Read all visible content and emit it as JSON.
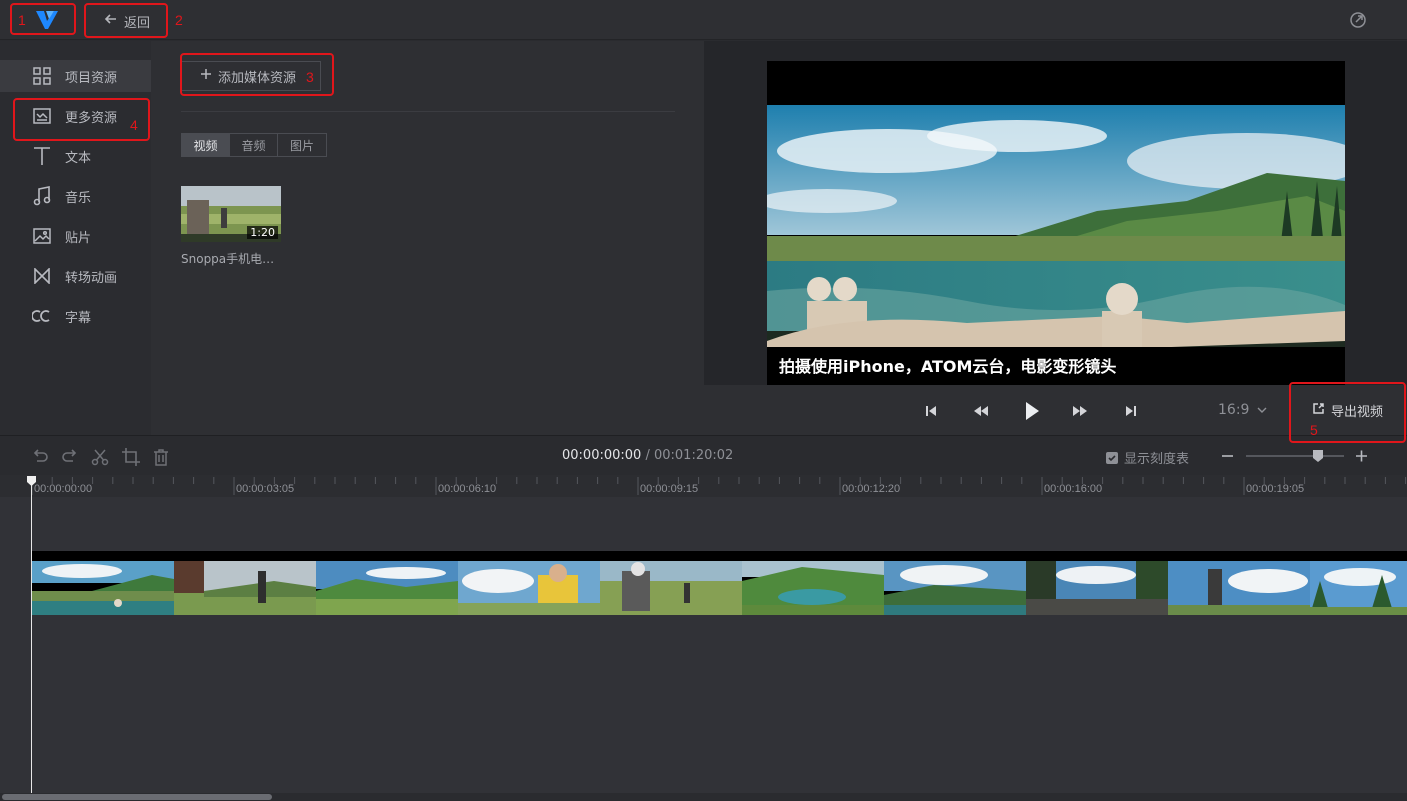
{
  "topbar": {
    "back_label": "返回"
  },
  "annotations": [
    "1",
    "2",
    "3",
    "4",
    "5"
  ],
  "sidebar": {
    "items": [
      {
        "label": "项目资源",
        "icon": "grid-icon",
        "active": true
      },
      {
        "label": "更多资源",
        "icon": "resource-box-icon",
        "active": false
      },
      {
        "label": "文本",
        "icon": "text-icon",
        "active": false
      },
      {
        "label": "音乐",
        "icon": "music-note-icon",
        "active": false
      },
      {
        "label": "贴片",
        "icon": "image-icon",
        "active": false
      },
      {
        "label": "转场动画",
        "icon": "transition-icon",
        "active": false
      },
      {
        "label": "字幕",
        "icon": "cc-icon",
        "active": false
      }
    ]
  },
  "media": {
    "add_label": "添加媒体资源",
    "tabs": [
      {
        "label": "视频",
        "active": true
      },
      {
        "label": "音频",
        "active": false
      },
      {
        "label": "图片",
        "active": false
      }
    ],
    "clip": {
      "name": "Snoppa手机电…",
      "duration": "1:20"
    }
  },
  "preview": {
    "subtitle": "拍摄使用iPhone，ATOM云台，电影变形镜头",
    "ratio": "16:9",
    "export_label": "导出视频"
  },
  "timeline": {
    "current": "00:00:00:00",
    "separator": "/",
    "total": "00:01:20:02",
    "show_scale_label": "显示刻度表",
    "show_scale_checked": true,
    "ruler_labels": [
      "00:00:00:00",
      "00:00:03:05",
      "00:00:06:10",
      "00:00:09:15",
      "00:00:12:20",
      "00:00:16:00",
      "00:00:19:05"
    ]
  },
  "colors": {
    "accent": "#1e88ff",
    "annotation": "#e0161b"
  }
}
